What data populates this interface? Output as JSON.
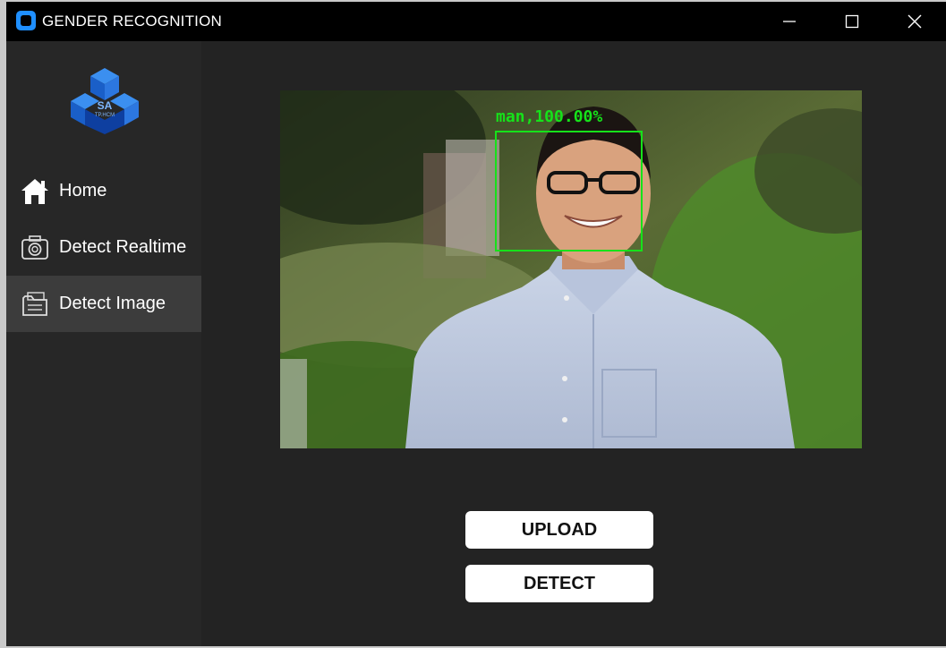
{
  "window": {
    "title": "GENDER RECOGNITION"
  },
  "logo": {
    "text_main": "SA",
    "text_sub": "TP.HCM"
  },
  "sidebar": {
    "items": [
      {
        "label": "Home",
        "icon": "home-icon"
      },
      {
        "label": "Detect Realtime",
        "icon": "camera-icon"
      },
      {
        "label": "Detect Image",
        "icon": "folder-icon",
        "active": true
      }
    ]
  },
  "detection": {
    "label": "man,100.00%",
    "box_color": "#16e21a"
  },
  "buttons": {
    "upload": "UPLOAD",
    "detect": "DETECT"
  },
  "colors": {
    "sidebar_bg": "#272727",
    "main_bg": "#232323",
    "active_item": "#3c3c3c",
    "accent": "#1f8fff"
  }
}
